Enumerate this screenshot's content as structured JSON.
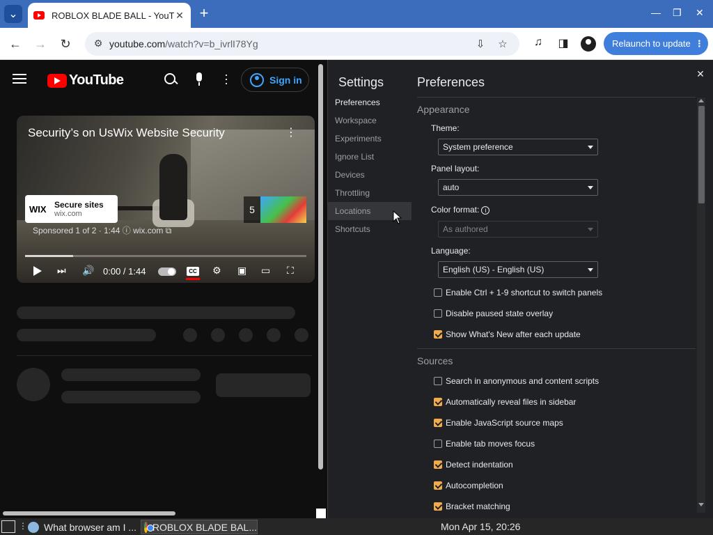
{
  "browser": {
    "tab_title": "ROBLOX BLADE BALL - YouTube",
    "url_host": "youtube.com",
    "url_path": "/watch?v=b_ivrlI78Yg",
    "relaunch_label": "Relaunch to update",
    "relaunch_more": "⋮"
  },
  "youtube": {
    "logo_text": "YouTube",
    "signin_label": "Sign in",
    "video": {
      "title": "Security’s on Us⁣Wix Website Security",
      "ad_brand": "WIX",
      "ad_title": "Secure sites",
      "ad_domain": "wix.com",
      "next_count": "5",
      "sponsor_text": "Sponsored 1 of 2 · 1:44  ⓘ    wix.com ⧉",
      "time": "0:00 / 1:44",
      "cc_label": "CC",
      "progress": 0.17
    }
  },
  "devtools": {
    "nav_title": "Settings",
    "nav_items": [
      "Preferences",
      "Workspace",
      "Experiments",
      "Ignore List",
      "Devices",
      "Throttling",
      "Locations",
      "Shortcuts"
    ],
    "header": "Preferences",
    "appearance": {
      "title": "Appearance",
      "theme_label": "Theme:",
      "theme_value": "System preference",
      "panel_layout_label": "Panel layout:",
      "panel_layout_value": "auto",
      "color_format_label": "Color format:",
      "color_format_value": "As authored",
      "language_label": "Language:",
      "language_value": "English (US) - English (US)",
      "checks": [
        {
          "label": "Enable Ctrl + 1-9 shortcut to switch panels",
          "checked": false
        },
        {
          "label": "Disable paused state overlay",
          "checked": false
        },
        {
          "label": "Show What's New after each update",
          "checked": true
        }
      ]
    },
    "sources": {
      "title": "Sources",
      "checks": [
        {
          "label": "Search in anonymous and content scripts",
          "checked": false
        },
        {
          "label": "Automatically reveal files in sidebar",
          "checked": true
        },
        {
          "label": "Enable JavaScript source maps",
          "checked": true
        },
        {
          "label": "Enable tab moves focus",
          "checked": false
        },
        {
          "label": "Detect indentation",
          "checked": true
        },
        {
          "label": "Autocompletion",
          "checked": true
        },
        {
          "label": "Bracket matching",
          "checked": true
        }
      ]
    }
  },
  "taskbar": {
    "item1": "What browser am I ...",
    "item2": "ROBLOX BLADE BAL...",
    "clock": "Mon Apr 15, 20:26"
  }
}
